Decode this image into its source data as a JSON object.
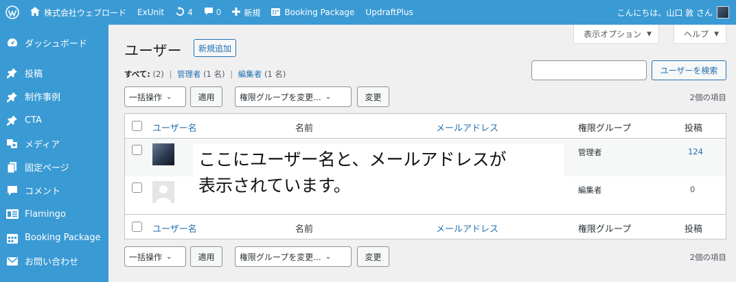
{
  "adminbar": {
    "site_name": "株式会社ウェブロード",
    "exunit": "ExUnit",
    "updates_count": "4",
    "comments_count": "0",
    "new_label": "新規",
    "booking": "Booking Package",
    "updraft": "UpdraftPlus",
    "greeting": "こんにちは、山口 敦 さん"
  },
  "sidebar": {
    "items": [
      {
        "label": "ダッシュボード",
        "icon": "dashboard-icon"
      },
      {
        "label": "投稿",
        "icon": "pin-icon"
      },
      {
        "label": "制作事例",
        "icon": "pin-icon"
      },
      {
        "label": "CTA",
        "icon": "pin-icon"
      },
      {
        "label": "メディア",
        "icon": "media-icon"
      },
      {
        "label": "固定ページ",
        "icon": "page-icon"
      },
      {
        "label": "コメント",
        "icon": "comment-icon"
      },
      {
        "label": "Flamingo",
        "icon": "flamingo-icon"
      },
      {
        "label": "Booking Package",
        "icon": "calendar-icon"
      },
      {
        "label": "お問い合わせ",
        "icon": "mail-icon"
      }
    ]
  },
  "header": {
    "screen_options": "表示オプション",
    "help": "ヘルプ",
    "title": "ユーザー",
    "add_new": "新規追加"
  },
  "filters": {
    "all": "すべて",
    "all_count": "(2)",
    "admin": "管理者",
    "admin_count": "(1 名)",
    "editor": "編集者",
    "editor_count": "(1 名)"
  },
  "search": {
    "button": "ユーザーを検索",
    "placeholder": ""
  },
  "tablenav": {
    "bulk_action": "一括操作",
    "apply": "適用",
    "change_role": "権限グループを変更...",
    "change": "変更",
    "items_count": "2個の項目"
  },
  "table": {
    "columns": {
      "username": "ユーザー名",
      "name": "名前",
      "email": "メールアドレス",
      "role": "権限グループ",
      "posts": "投稿"
    },
    "rows": [
      {
        "role": "管理者",
        "posts": "124"
      },
      {
        "role": "編集者",
        "posts": "0"
      }
    ]
  },
  "overlay": {
    "line1": "ここにユーザー名と、メールアドレスが",
    "line2": "表示されています。"
  },
  "colors": {
    "sidebar": "#3a9ad4",
    "link": "#2271b1",
    "background": "#f0f0f1"
  }
}
